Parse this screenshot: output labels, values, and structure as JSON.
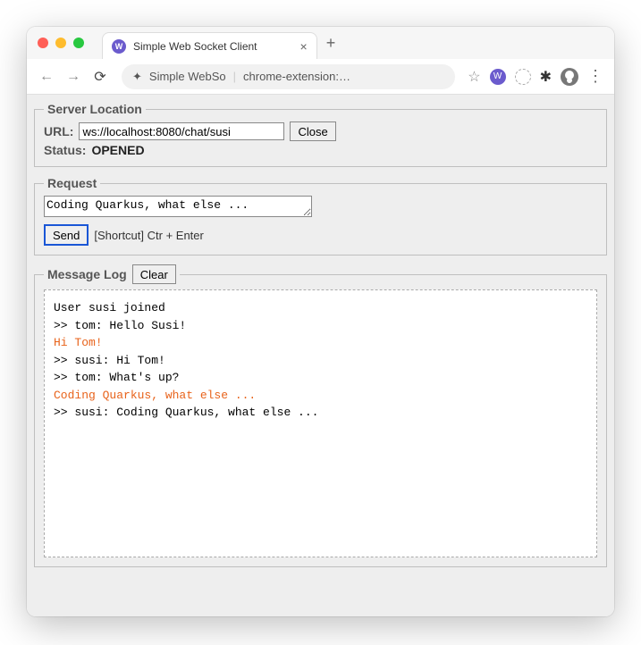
{
  "tab": {
    "title": "Simple Web Socket Client"
  },
  "omnibox": {
    "ext_name": "Simple WebSo",
    "url_display": "chrome-extension:…"
  },
  "server": {
    "legend": "Server Location",
    "url_label": "URL:",
    "url_value": "ws://localhost:8080/chat/susi",
    "close_label": "Close",
    "status_label": "Status:",
    "status_value": "OPENED"
  },
  "request": {
    "legend": "Request",
    "body": "Coding Quarkus, what else ...",
    "send_label": "Send",
    "shortcut_text": "[Shortcut] Ctr + Enter"
  },
  "log": {
    "legend": "Message Log",
    "clear_label": "Clear",
    "lines": [
      {
        "text": "User susi joined",
        "kind": "incoming"
      },
      {
        "text": ">> tom: Hello Susi!",
        "kind": "incoming"
      },
      {
        "text": "Hi Tom!",
        "kind": "outgoing"
      },
      {
        "text": ">> susi: Hi Tom!",
        "kind": "incoming"
      },
      {
        "text": ">> tom: What's up?",
        "kind": "incoming"
      },
      {
        "text": "Coding Quarkus, what else ...",
        "kind": "outgoing"
      },
      {
        "text": ">> susi: Coding Quarkus, what else ...",
        "kind": "incoming"
      }
    ]
  }
}
